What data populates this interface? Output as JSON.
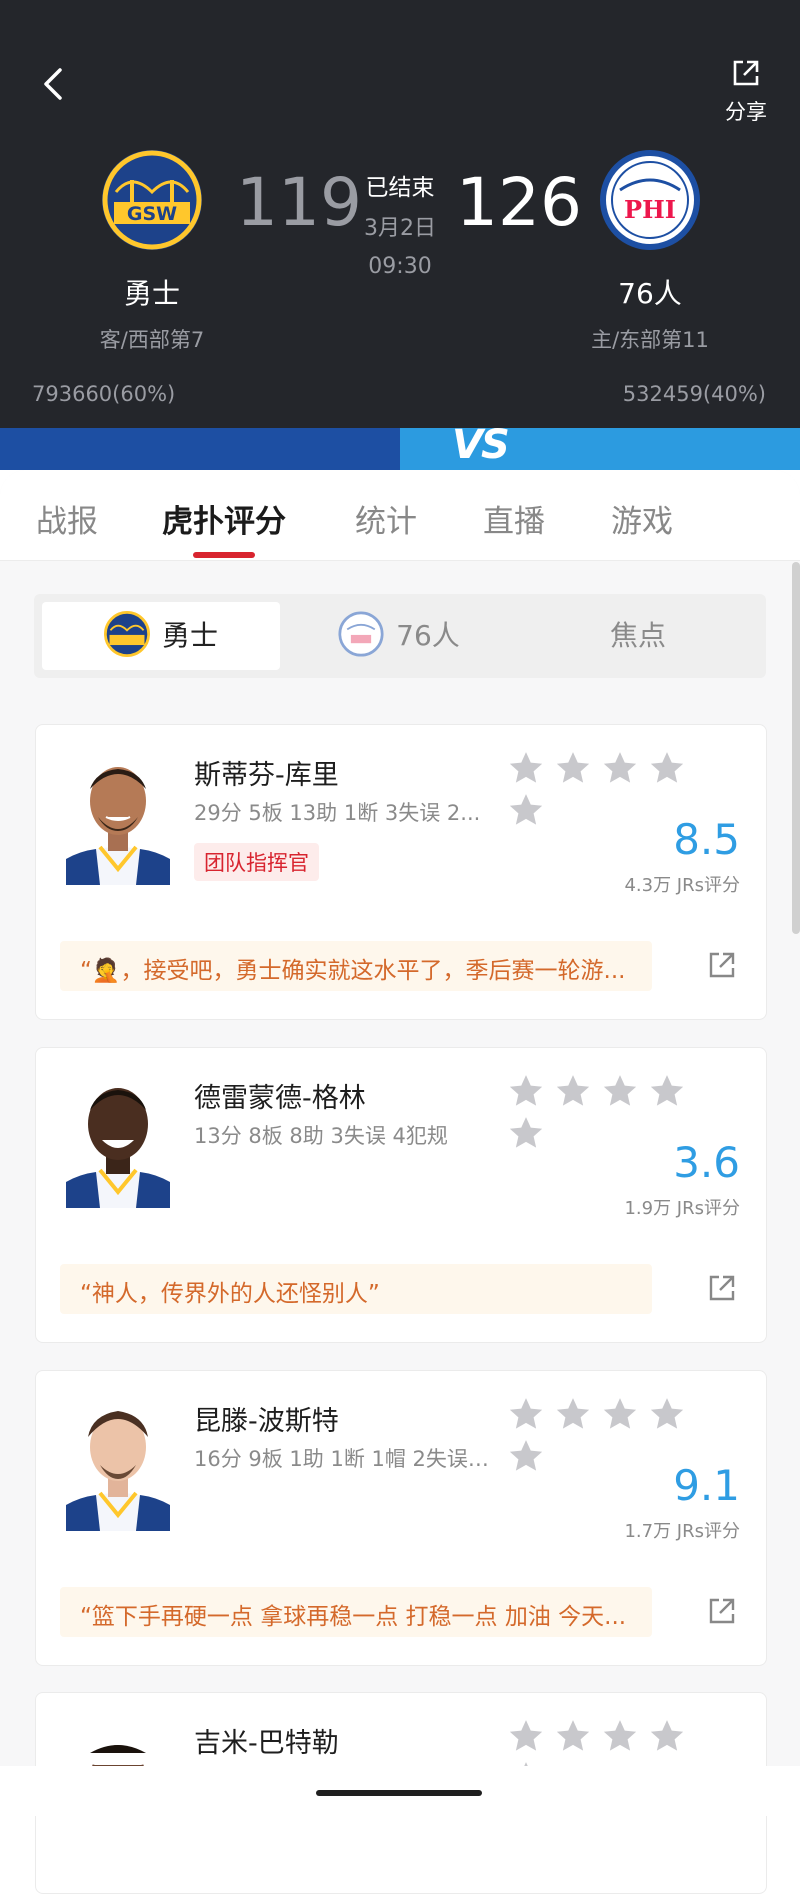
{
  "header": {
    "share_label": "分享",
    "away": {
      "name": "勇士",
      "score": "119",
      "rank": "客/西部第7",
      "support": "793660(60%)",
      "logo_text": "GSW",
      "color": "#1d428a"
    },
    "home": {
      "name": "76人",
      "score": "126",
      "rank": "主/东部第11",
      "support": "532459(40%)",
      "logo_text": "PHI",
      "color": "#1d4fa3"
    },
    "status": "已结束",
    "date": "3月2日",
    "time": "09:30",
    "vs_label": "VS"
  },
  "tabs": [
    "战报",
    "虎扑评分",
    "统计",
    "直播",
    "游戏"
  ],
  "active_tab": "虎扑评分",
  "segment": {
    "items": [
      "勇士",
      "76人",
      "焦点"
    ],
    "active": "勇士"
  },
  "players": [
    {
      "name": "斯蒂芬-库里",
      "stats": "29分 5板 13助 1断 3失误 2...",
      "tag": "团队指挥官",
      "rating": "8.5",
      "votes": "4.3万 JRs评分",
      "quote": "“🤦，接受吧，勇士确实就这水平了，季后赛一轮游..."
    },
    {
      "name": "德雷蒙德-格林",
      "stats": "13分 8板 8助 3失误 4犯规",
      "tag": "",
      "rating": "3.6",
      "votes": "1.9万 JRs评分",
      "quote": "“神人，传界外的人还怪别人”"
    },
    {
      "name": "昆滕-波斯特",
      "stats": "16分 9板 1助 1断 1帽 2失误 ...",
      "tag": "",
      "rating": "9.1",
      "votes": "1.7万 JRs评分",
      "quote": "“篮下手再硬一点 拿球再稳一点 打稳一点 加油 今天..."
    },
    {
      "name": "吉米-巴特勒"
    }
  ],
  "colors": {
    "header_bg": "#24262b",
    "accent_red": "#d8242f",
    "rating_blue": "#2f9de3",
    "quote_orange": "#d4692b"
  }
}
